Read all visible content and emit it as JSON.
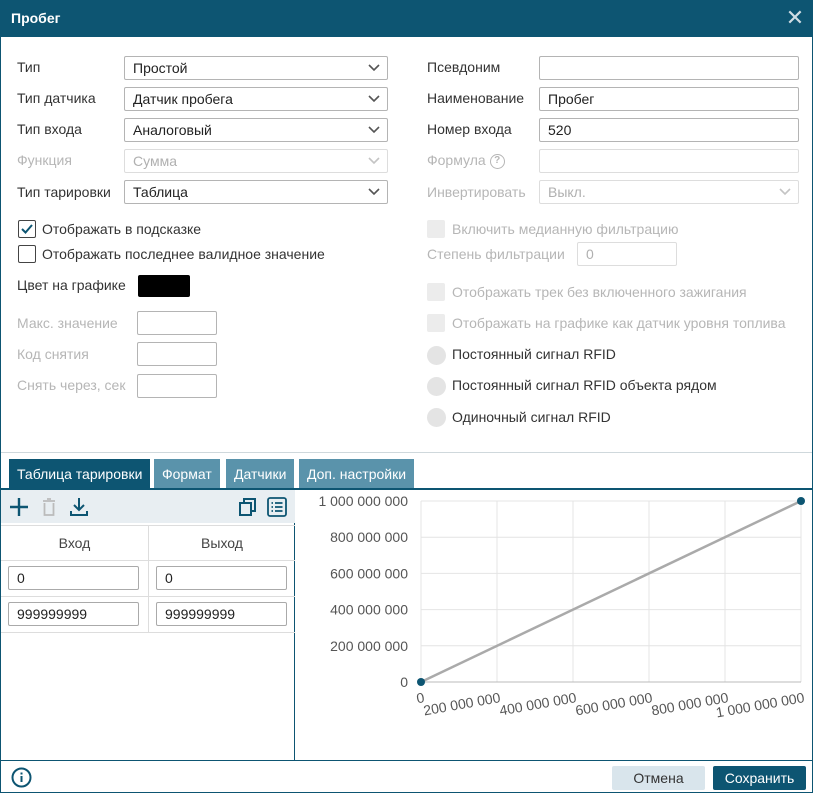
{
  "window": {
    "title": "Пробег"
  },
  "left_fields": [
    {
      "label": "Тип",
      "value": "Простой",
      "disabled": false
    },
    {
      "label": "Тип датчика",
      "value": "Датчик пробега",
      "disabled": false
    },
    {
      "label": "Тип входа",
      "value": "Аналоговый",
      "disabled": false
    },
    {
      "label": "Функция",
      "value": "Сумма",
      "disabled": true
    },
    {
      "label": "Тип тарировки",
      "value": "Таблица",
      "disabled": false
    }
  ],
  "right_fields": [
    {
      "label": "Псевдоним",
      "value": ""
    },
    {
      "label": "Наименование",
      "value": "Пробег"
    },
    {
      "label": "Номер входа",
      "value": "520"
    },
    {
      "label": "Формула",
      "value": ""
    },
    {
      "label": "Инвертировать",
      "value": "Выкл."
    }
  ],
  "formula_help": "?",
  "checkboxes_left": [
    {
      "label": "Отображать в подсказке",
      "checked": true
    },
    {
      "label": "Отображать последнее валидное значение",
      "checked": false
    }
  ],
  "color_label": "Цвет на графике",
  "swatch_color": "#000000",
  "left_small_fields": [
    {
      "label": "Макс. значение",
      "value": ""
    },
    {
      "label": "Код снятия",
      "value": ""
    },
    {
      "label": "Снять через, сек",
      "value": ""
    }
  ],
  "median_filter": {
    "label": "Включить медианную фильтрацию",
    "checked": false
  },
  "filter_degree": {
    "label": "Степень фильтрации",
    "placeholder": "0"
  },
  "track_checkboxes": [
    {
      "label": "Отображать трек без включенного зажигания",
      "checked": false
    },
    {
      "label": "Отображать на графике как датчик уровня топлива",
      "checked": false
    }
  ],
  "rfid_radios": [
    {
      "label": "Постоянный сигнал RFID"
    },
    {
      "label": "Постоянный сигнал RFID объекта рядом"
    },
    {
      "label": "Одиночный сигнал RFID"
    }
  ],
  "tabs": [
    {
      "label": "Таблица тарировки",
      "active": true
    },
    {
      "label": "Формат",
      "active": false
    },
    {
      "label": "Датчики",
      "active": false
    },
    {
      "label": "Доп. настройки",
      "active": false
    }
  ],
  "table": {
    "headers": [
      "Вход",
      "Выход"
    ],
    "rows": [
      [
        "0",
        "0"
      ],
      [
        "999999999",
        "999999999"
      ]
    ]
  },
  "chart_data": {
    "type": "line",
    "x_ticks": [
      "0",
      "200 000 000",
      "400 000 000",
      "600 000 000",
      "800 000 000",
      "1 000 000 000"
    ],
    "y_ticks": [
      "0",
      "200 000 000",
      "400 000 000",
      "600 000 000",
      "800 000 000",
      "1 000 000 000"
    ],
    "xlim": [
      0,
      1000000000
    ],
    "ylim": [
      0,
      1000000000
    ],
    "x": [
      0,
      999999999
    ],
    "y": [
      0,
      999999999
    ],
    "line_color": "#aaaaaa",
    "point_color": "#0d5572",
    "grid": true
  },
  "footer": {
    "cancel": "Отмена",
    "save": "Сохранить"
  },
  "colors": {
    "primary": "#0d5572",
    "tab_inactive": "#5a93ab"
  }
}
